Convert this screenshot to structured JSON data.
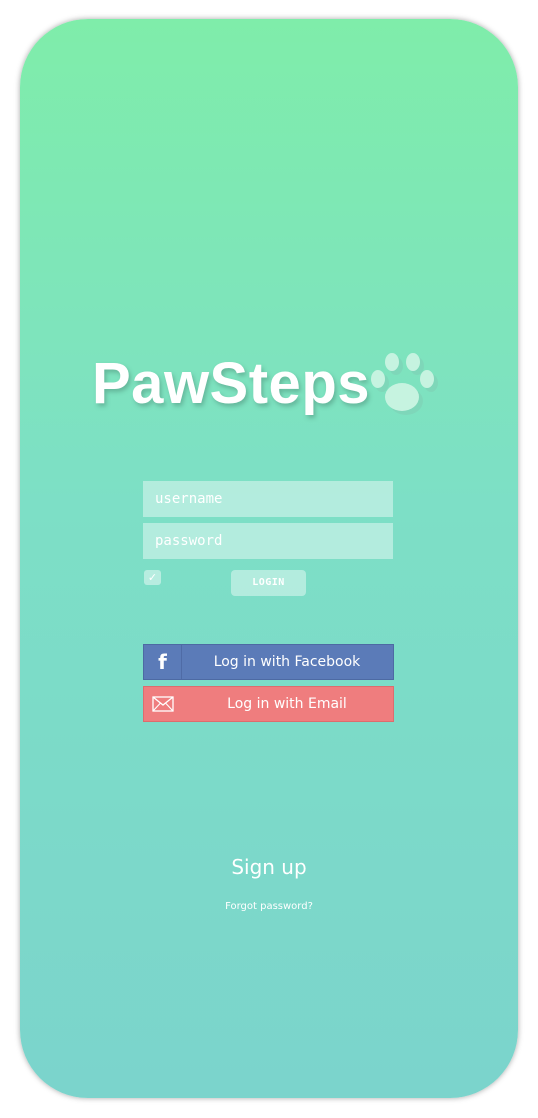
{
  "app": {
    "logo_text": "PawSteps"
  },
  "login_form": {
    "username_placeholder": "username",
    "password_placeholder": "password",
    "remember_checked": true,
    "checkbox_glyph": "✓",
    "login_label": "LOGIN"
  },
  "social": {
    "facebook_label": "Log in with Facebook",
    "facebook_icon": "facebook-icon",
    "email_label": "Log in with Email",
    "email_icon": "envelope-icon"
  },
  "footer": {
    "signup_label": "Sign up",
    "forgot_label": "Forgot password?"
  },
  "colors": {
    "gradient_top": "#7fedaa",
    "gradient_bottom": "#7bd4cc",
    "facebook_blue": "#5b7bb8",
    "email_red": "#ef7d7e"
  }
}
